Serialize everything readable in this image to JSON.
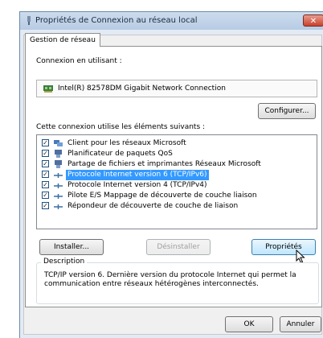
{
  "window": {
    "title": "Propriétés de Connexion au réseau local",
    "close_glyph": "✕"
  },
  "tab": {
    "label": "Gestion de réseau"
  },
  "connect_using": {
    "label": "Connexion en utilisant :",
    "adapter": "Intel(R) 82578DM Gigabit Network Connection",
    "configure_button": "Configurer..."
  },
  "items_label": "Cette connexion utilise les éléments suivants :",
  "items": [
    {
      "label": "Client pour les réseaux Microsoft",
      "checked": true,
      "icon": "network-client-icon"
    },
    {
      "label": "Planificateur de paquets QoS",
      "checked": true,
      "icon": "qos-icon"
    },
    {
      "label": "Partage de fichiers et imprimantes Réseaux Microsoft",
      "checked": true,
      "icon": "file-printer-sharing-icon"
    },
    {
      "label": "Protocole Internet version 6 (TCP/IPv6)",
      "checked": true,
      "icon": "protocol-icon",
      "selected": true
    },
    {
      "label": "Protocole Internet version 4 (TCP/IPv4)",
      "checked": true,
      "icon": "protocol-icon"
    },
    {
      "label": "Pilote E/S Mappage de découverte de couche liaison",
      "checked": true,
      "icon": "protocol-icon"
    },
    {
      "label": "Répondeur de découverte de couche de liaison",
      "checked": true,
      "icon": "protocol-icon"
    }
  ],
  "buttons": {
    "install": "Installer...",
    "uninstall": "Désinstaller",
    "properties": "Propriétés",
    "ok": "OK",
    "cancel": "Annuler"
  },
  "description": {
    "label": "Description",
    "text": "TCP/IP version 6. Dernière version du protocole Internet qui permet la communication entre réseaux hétérogènes interconnectés."
  },
  "colors": {
    "selection": "#3399ff",
    "titlebar": "#b7cbe3",
    "close": "#c9422c"
  }
}
